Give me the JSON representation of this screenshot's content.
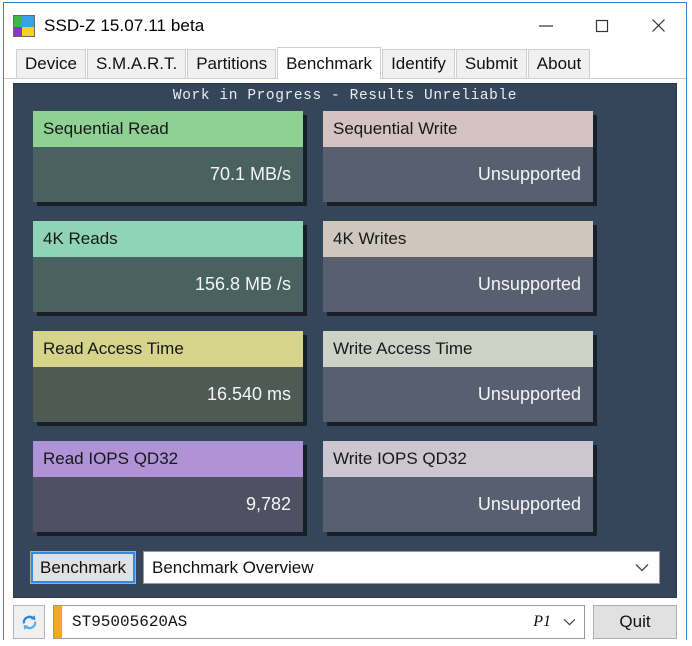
{
  "window": {
    "title": "SSD-Z 15.07.11 beta",
    "icon": "app-logo-icon",
    "icon_colors": {
      "top_left": "#3dbb3d",
      "top_right": "#3aa0e8",
      "bottom_left": "#8a35c9",
      "bottom_right": "#f2d024"
    },
    "controls": {
      "minimize": "minimize-icon",
      "maximize": "maximize-icon",
      "close": "close-icon"
    }
  },
  "tabs": [
    {
      "label": "Device",
      "active": false
    },
    {
      "label": "S.M.A.R.T.",
      "active": false
    },
    {
      "label": "Partitions",
      "active": false
    },
    {
      "label": "Benchmark",
      "active": true
    },
    {
      "label": "Identify",
      "active": false
    },
    {
      "label": "Submit",
      "active": false
    },
    {
      "label": "About",
      "active": false
    }
  ],
  "panel": {
    "banner": "Work in Progress - Results Unreliable",
    "background": "#36465a"
  },
  "cards": [
    {
      "title": "Sequential Read",
      "value": "70.1 MB/s",
      "head_color": "#8ed192",
      "body_color": "#4a6161"
    },
    {
      "title": "Sequential Write",
      "value": "Unsupported",
      "head_color": "#d4c3c0",
      "body_color": "#586070"
    },
    {
      "title": "4K Reads",
      "value": "156.8 MB /s",
      "head_color": "#8fd4b4",
      "body_color": "#4a6161"
    },
    {
      "title": "4K Writes",
      "value": "Unsupported",
      "head_color": "#cfc7bc",
      "body_color": "#586070"
    },
    {
      "title": "Read Access Time",
      "value": "16.540 ms",
      "head_color": "#d6d48b",
      "body_color": "#4f5a55"
    },
    {
      "title": "Write Access Time",
      "value": "Unsupported",
      "head_color": "#cdd2c6",
      "body_color": "#586070"
    },
    {
      "title": "Read IOPS QD32",
      "value": "9,782",
      "head_color": "#b092d6",
      "body_color": "#4f5163"
    },
    {
      "title": "Write IOPS QD32",
      "value": "Unsupported",
      "head_color": "#cbc6d0",
      "body_color": "#586070"
    }
  ],
  "benchmark_controls": {
    "run_button": "Benchmark",
    "view_select_value": "Benchmark Overview",
    "view_select_chevron": "chevron-down-icon"
  },
  "statusbar": {
    "refresh_icon": "refresh-icon",
    "drive_name": "ST95005620AS",
    "partition": "P1",
    "drive_chevron": "chevron-down-icon",
    "quit_button": "Quit",
    "drive_accent": "#f5a623"
  }
}
